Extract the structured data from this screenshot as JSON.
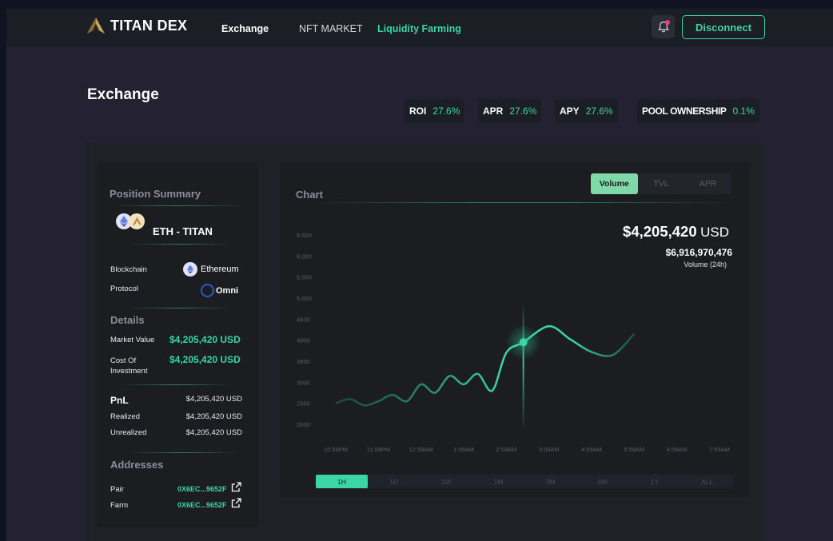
{
  "brand": {
    "name": "TITAN DEX"
  },
  "nav": {
    "exchange": "Exchange",
    "nft": "NFT MARKET",
    "farming": "Liquidity Farming"
  },
  "header": {
    "disconnect": "Disconnect"
  },
  "page": {
    "title": "Exchange"
  },
  "stats": [
    {
      "label": "ROI",
      "value": "27.6%"
    },
    {
      "label": "APR",
      "value": "27.6%"
    },
    {
      "label": "APY",
      "value": "27.6%"
    },
    {
      "label": "POOL OWNERSHIP",
      "value": "0.1%"
    }
  ],
  "summary": {
    "title": "Position Summary",
    "pair": "ETH - TITAN",
    "blockchain_label": "Blockchain",
    "blockchain_value": "Ethereum",
    "protocol_label": "Protocol",
    "protocol_value": "Omni",
    "details_title": "Details",
    "market_value_label": "Market Value",
    "market_value": "$4,205,420 USD",
    "cost_label": "Cost Of Investment",
    "cost_value": "$4,205,420 USD",
    "pnl_label": "PnL",
    "pnl_value": "$4,205,420 USD",
    "realized_label": "Realized",
    "realized_value": "$4,205,420 USD",
    "unrealized_label": "Unrealized",
    "unrealized_value": "$4,205,420 USD",
    "addresses_title": "Addresses",
    "pair_label": "Pair",
    "pair_addr": "0X6EC...9652F",
    "farm_label": "Farm",
    "farm_addr": "0X6EC...9652F"
  },
  "chart": {
    "title": "Chart",
    "tabs": [
      "Volume",
      "TVL",
      "APR"
    ],
    "active_tab": "Volume",
    "price_amount": "$4,205,420",
    "price_unit": "USD",
    "volume_value": "$6,916,970,476",
    "volume_label": "Volume (24h)",
    "timeframes": [
      "1H",
      "1D",
      "1W",
      "1M",
      "3M",
      "6M",
      "1Y",
      "ALL"
    ],
    "active_timeframe": "1H",
    "accent": "#3bd6a3"
  },
  "chart_data": {
    "type": "line",
    "x": [
      "10:59PM",
      "11:59PM",
      "12:59AM",
      "1:59AM",
      "2:59AM",
      "3:59AM",
      "4:59AM",
      "5:59AM",
      "6:59AM",
      "7:59AM"
    ],
    "yticks": [
      "6.500",
      "6.000",
      "5.500",
      "5.000",
      "4500",
      "4000",
      "3500",
      "3000",
      "2500",
      "2000"
    ],
    "ylim": [
      2000,
      6500
    ],
    "points": [
      [
        0.0,
        2500
      ],
      [
        0.33,
        2600
      ],
      [
        0.67,
        2450
      ],
      [
        1.0,
        2550
      ],
      [
        1.33,
        2700
      ],
      [
        1.67,
        2550
      ],
      [
        2.0,
        2950
      ],
      [
        2.33,
        2750
      ],
      [
        2.67,
        3150
      ],
      [
        3.0,
        2950
      ],
      [
        3.33,
        3200
      ],
      [
        3.67,
        2800
      ],
      [
        4.0,
        3700
      ],
      [
        4.4,
        3950
      ],
      [
        5.0,
        4330
      ],
      [
        5.5,
        4020
      ],
      [
        6.0,
        3720
      ],
      [
        6.5,
        3650
      ],
      [
        7.0,
        4150
      ]
    ],
    "highlight": {
      "x": 4.4,
      "y": 3950
    }
  }
}
